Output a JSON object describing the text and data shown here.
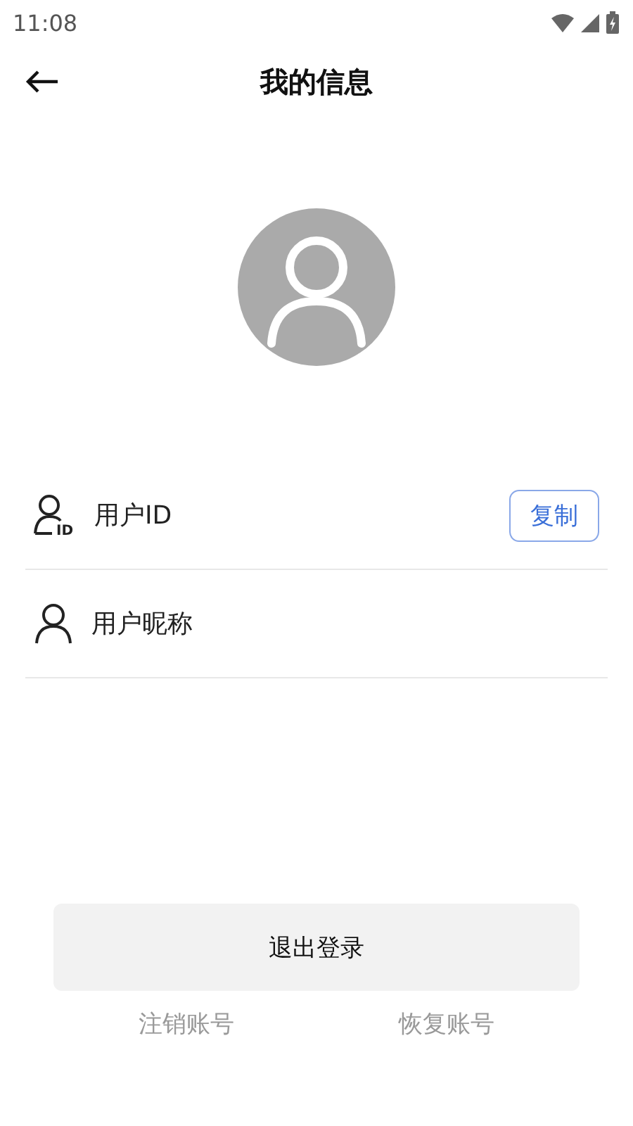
{
  "status_bar": {
    "time": "11:08"
  },
  "header": {
    "title": "我的信息"
  },
  "rows": [
    {
      "kind": "id",
      "icon_badge": "ID",
      "label": "用户ID",
      "action": "复制"
    },
    {
      "kind": "nickname",
      "label": "用户昵称"
    }
  ],
  "logout_button": "退出登录",
  "links": [
    "注销账号",
    "恢复账号"
  ]
}
